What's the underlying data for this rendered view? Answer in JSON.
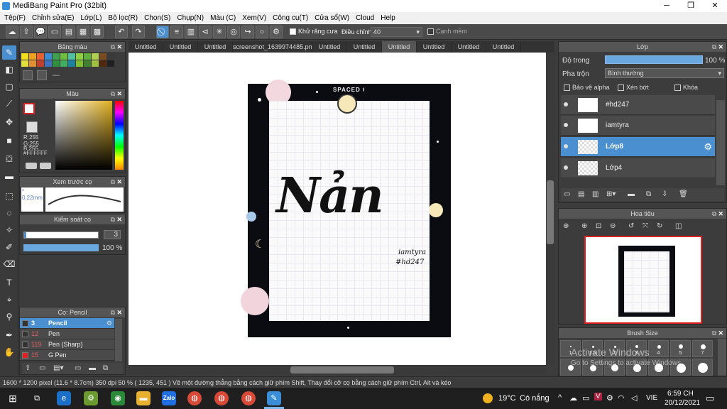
{
  "titlebar": {
    "title": "MediBang Paint Pro (32bit)"
  },
  "menu": [
    "Tệp(F)",
    "Chỉnh sửa(E)",
    "Lớp(L)",
    "Bộ lọc(R)",
    "Chọn(S)",
    "Chụp(N)",
    "Màu (C)",
    "Xem(V)",
    "Công cụ(T)",
    "Cửa sổ(W)",
    "Cloud",
    "Help"
  ],
  "toolbar": {
    "antialias_label": "Khử răng cưa",
    "adjust_label": "Điều chỉnh",
    "adjust_value": "40",
    "edge_label": "Cạnh mềm"
  },
  "tabs": [
    "Untitled",
    "Untitled",
    "Untitled",
    "screenshot_1639974485.png",
    "Untitled",
    "Untitled",
    "Untitled",
    "Untitled",
    "Untitled",
    "Untitled"
  ],
  "swatches_panel": {
    "title": "Bảng màu",
    "name": "---"
  },
  "color_panel": {
    "title": "Màu",
    "r": "R:255",
    "g": "G:255",
    "b": "B:255",
    "hex": "#FFFFFF"
  },
  "brush_preview_panel": {
    "title": "Xem trước cọ",
    "size": "0.22mm"
  },
  "brush_control_panel": {
    "title": "Kiểm soát cọ",
    "size_value": "3",
    "opacity_value": "100 %"
  },
  "brush_list_panel": {
    "title": "Cọ: Pencil",
    "items": [
      {
        "size": "3",
        "name": "Pencil"
      },
      {
        "size": "12",
        "name": "Pen"
      },
      {
        "size": "119",
        "name": "Pen (Sharp)"
      },
      {
        "size": "15",
        "name": "G Pen"
      }
    ]
  },
  "layer_panel": {
    "title": "Lớp",
    "opacity_label": "Độ trong",
    "opacity_value": "100 %",
    "blend_label": "Pha trộn",
    "blend_value": "Bình thường",
    "protect_alpha": "Bảo vệ alpha",
    "clipping": "Xén bớt",
    "lock": "Khóa",
    "layers": [
      "#hd247",
      "iamtyra",
      "Lớp8",
      "Lớp4"
    ]
  },
  "navigator_panel": {
    "title": "Hoa tiêu"
  },
  "brush_size_panel": {
    "title": "Brush Size",
    "sizes": [
      "1",
      "1.5",
      "2",
      "3",
      "4",
      "5",
      "7"
    ]
  },
  "artwork": {
    "main_text": "Nản",
    "credit_line1": "iamtyra",
    "credit_line2": "#hd247",
    "badge_text": "SPACED OUT"
  },
  "statusbar": {
    "text": "1600 * 1200 pixel  (11.6 * 8.7cm)  350 dpi  50 %  ( 1235, 451 )  Vẽ một đường thẳng bằng cách giữ phím Shift, Thay đổi cỡ cọ bằng cách giữ phím Ctrl, Alt và kéo"
  },
  "watermark": {
    "line1": "Activate Windows",
    "line2": "Go to Settings to activate Windows."
  },
  "taskbar": {
    "weather_temp": "19°C",
    "weather_text": "Có nắng",
    "lang": "VIE",
    "time": "6:59 CH",
    "date": "20/12/2021",
    "zalo": "Zalo"
  },
  "colors": {
    "accent": "#4a90d0",
    "panel": "#3c3c3c",
    "header": "#555555",
    "selection_red": "#e02020"
  }
}
